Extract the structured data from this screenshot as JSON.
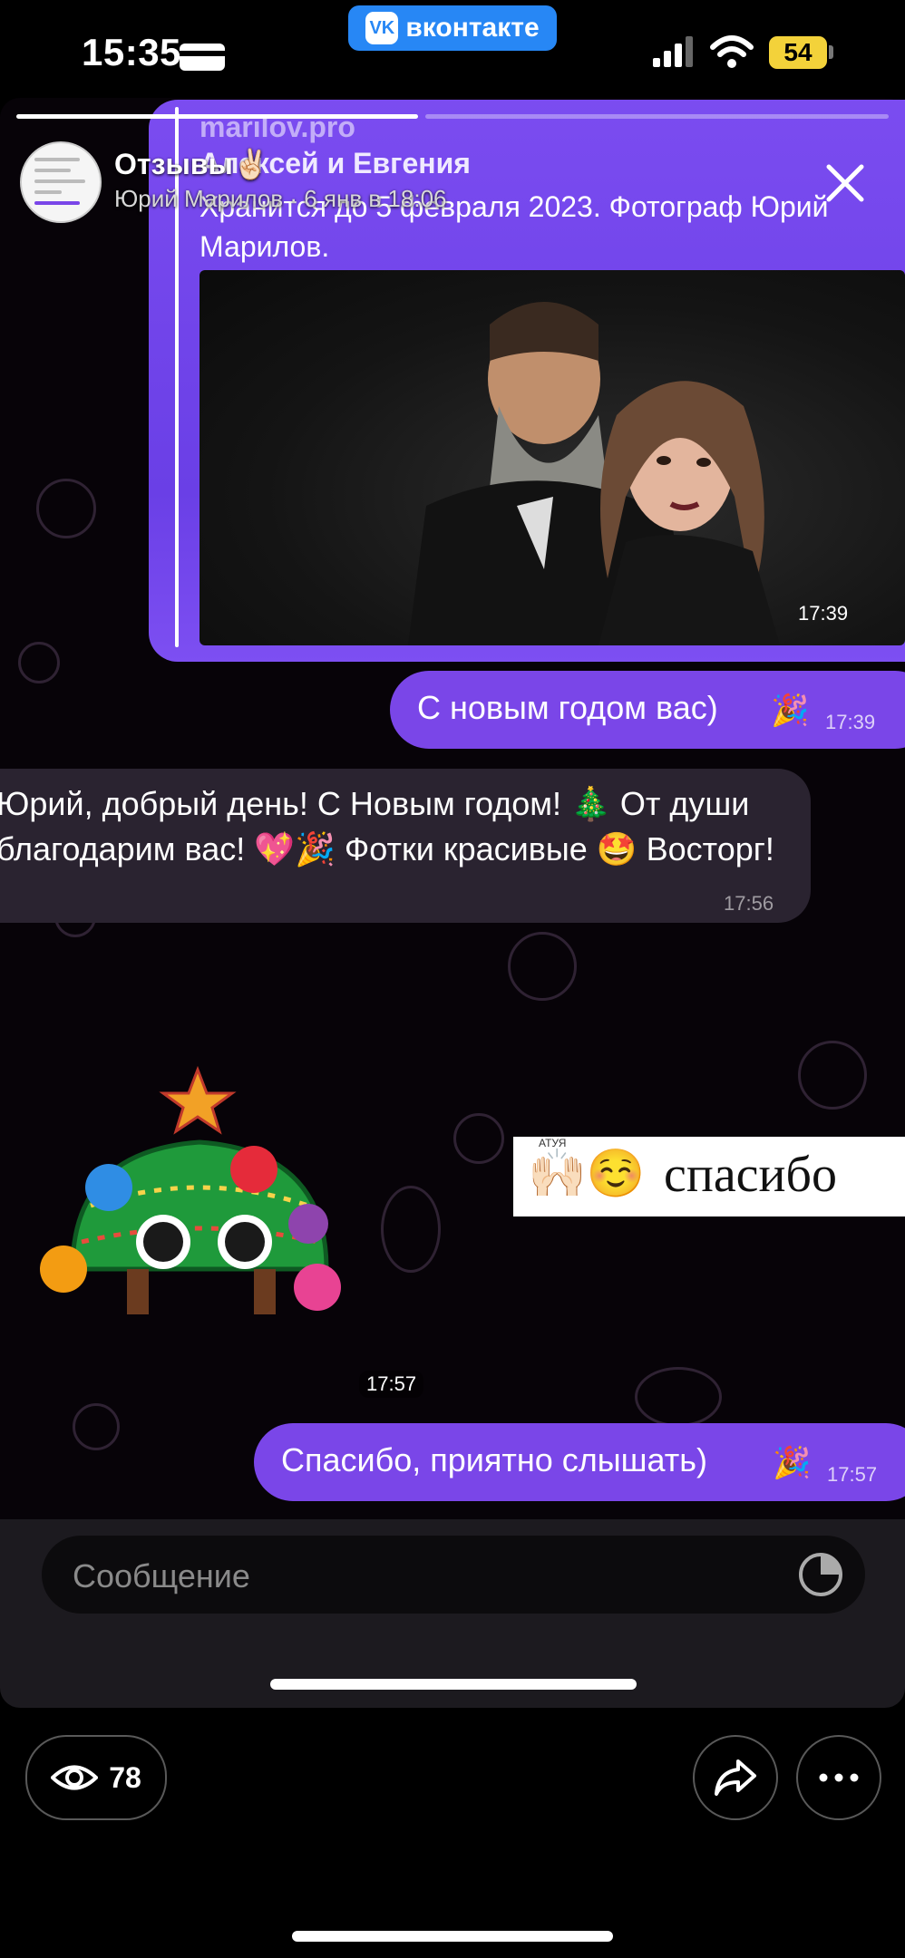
{
  "status_bar": {
    "time": "15:35",
    "vk_logo_text": "VK",
    "vk_label": "вконтакте",
    "battery": "54"
  },
  "story": {
    "title": "Отзывы✌🏻",
    "subtitle": "Юрий Марилов · 6 янв в 18:06",
    "progress": 0.46
  },
  "chat": {
    "forwarded": {
      "link": "marilov.pro",
      "names": "Алексей и Евгения",
      "text": "Хранится до 5 февраля 2023. Фотограф Юрий Марилов.",
      "time": "17:39"
    },
    "messages": [
      {
        "text": "С новым годом вас)",
        "emoji": "🎉",
        "time": "17:39"
      },
      {
        "text": "Юрий, добрый день! С Новым годом! 🎄 От души благодарим вас! 💖🎉 Фотки красивые 🤩 Восторг!",
        "time": "17:56"
      },
      {
        "time": "17:57"
      },
      {
        "text": "спасибо",
        "emoji": "🙌🏻☺️",
        "tiny": "АТУЯ"
      },
      {
        "text": "Спасибо, приятно слышать)",
        "emoji": "🎉",
        "time": "17:57"
      }
    ]
  },
  "composer": {
    "placeholder": "Сообщение"
  },
  "footer": {
    "views": "78"
  },
  "colors": {
    "accent": "#7a46e8",
    "vk_blue": "#2787f5",
    "battery": "#f3d23a"
  }
}
